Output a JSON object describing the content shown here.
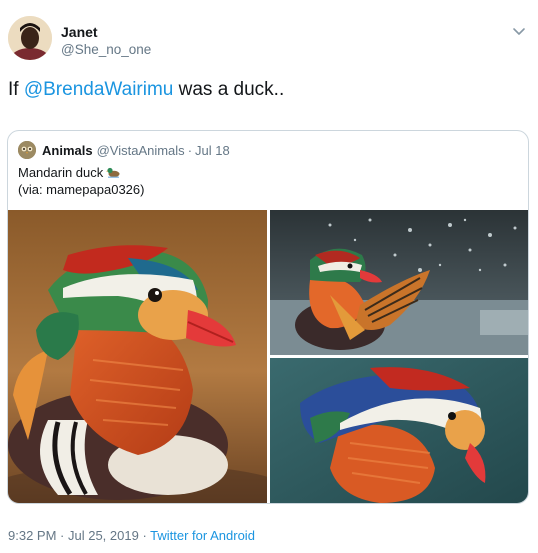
{
  "tweet": {
    "author_name": "Janet",
    "author_handle": "@She_no_one",
    "text_before": "If ",
    "mention": "@BrendaWairimu",
    "text_after": " was a duck..",
    "footer": {
      "time": "9:32 PM",
      "separator": " · ",
      "date": "Jul 25, 2019",
      "separator2": " · ",
      "source": "Twitter for Android"
    },
    "menu_icon": "chevron-down-icon"
  },
  "quoted": {
    "author_name": "Animals",
    "author_handle": "@VistaAnimals",
    "separator": "·",
    "date": "Jul 18",
    "line1": "Mandarin duck",
    "line1_emoji": "duck-emoji",
    "line2": "(via: mamepapa0326)",
    "photos": [
      "mandarin-duck-photo-1",
      "mandarin-duck-photo-2",
      "mandarin-duck-photo-3"
    ]
  },
  "colors": {
    "text": "#14171a",
    "muted": "#657786",
    "link": "#1b95e0",
    "border": "#ccd6dd"
  }
}
